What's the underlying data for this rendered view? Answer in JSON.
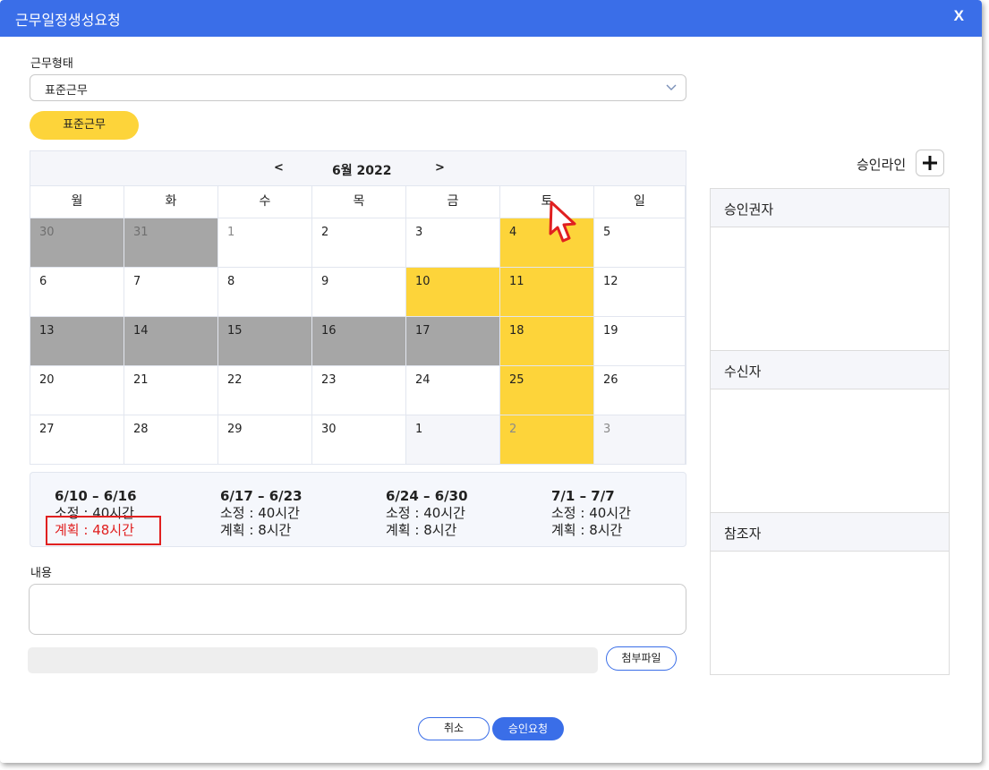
{
  "dialog": {
    "title": "근무일정생성요청",
    "close_label": "X"
  },
  "work_type": {
    "label": "근무형태",
    "selected": "표준근무",
    "tag": "표준근무"
  },
  "calendar": {
    "prev_label": "<",
    "next_label": ">",
    "month_label": "6월 2022",
    "weekdays": [
      "월",
      "화",
      "수",
      "목",
      "금",
      "토",
      "일"
    ],
    "weeks": [
      [
        "30",
        "31",
        "1",
        "2",
        "3",
        "4",
        "5"
      ],
      [
        "6",
        "7",
        "8",
        "9",
        "10",
        "11",
        "12"
      ],
      [
        "13",
        "14",
        "15",
        "16",
        "17",
        "18",
        "19"
      ],
      [
        "20",
        "21",
        "22",
        "23",
        "24",
        "25",
        "26"
      ],
      [
        "27",
        "28",
        "29",
        "30",
        "1",
        "2",
        "3"
      ]
    ],
    "colors": {
      "holiday_gray": "#a6a6a6",
      "planned_yellow": "#fdd43a",
      "next_month_bg": "#f5f6fa"
    }
  },
  "summary": [
    {
      "range": "6/10 – 6/16",
      "standard": "소정 : 40시간",
      "planned": "계획 : 48시간",
      "over": true
    },
    {
      "range": "6/17 – 6/23",
      "standard": "소정 : 40시간",
      "planned": "계획 : 8시간",
      "over": false
    },
    {
      "range": "6/24 – 6/30",
      "standard": "소정 : 40시간",
      "planned": "계획 : 8시간",
      "over": false
    },
    {
      "range": "7/1 – 7/7",
      "standard": "소정 : 40시간",
      "planned": "계획 : 8시간",
      "over": false
    }
  ],
  "content": {
    "label": "내용",
    "value": ""
  },
  "attachment": {
    "button_label": "첨부파일"
  },
  "footer": {
    "cancel_label": "취소",
    "submit_label": "승인요청"
  },
  "approval": {
    "line_label": "승인라인",
    "sections": [
      "승인권자",
      "수신자",
      "참조자"
    ]
  },
  "accent_color": "#3a6ee8"
}
